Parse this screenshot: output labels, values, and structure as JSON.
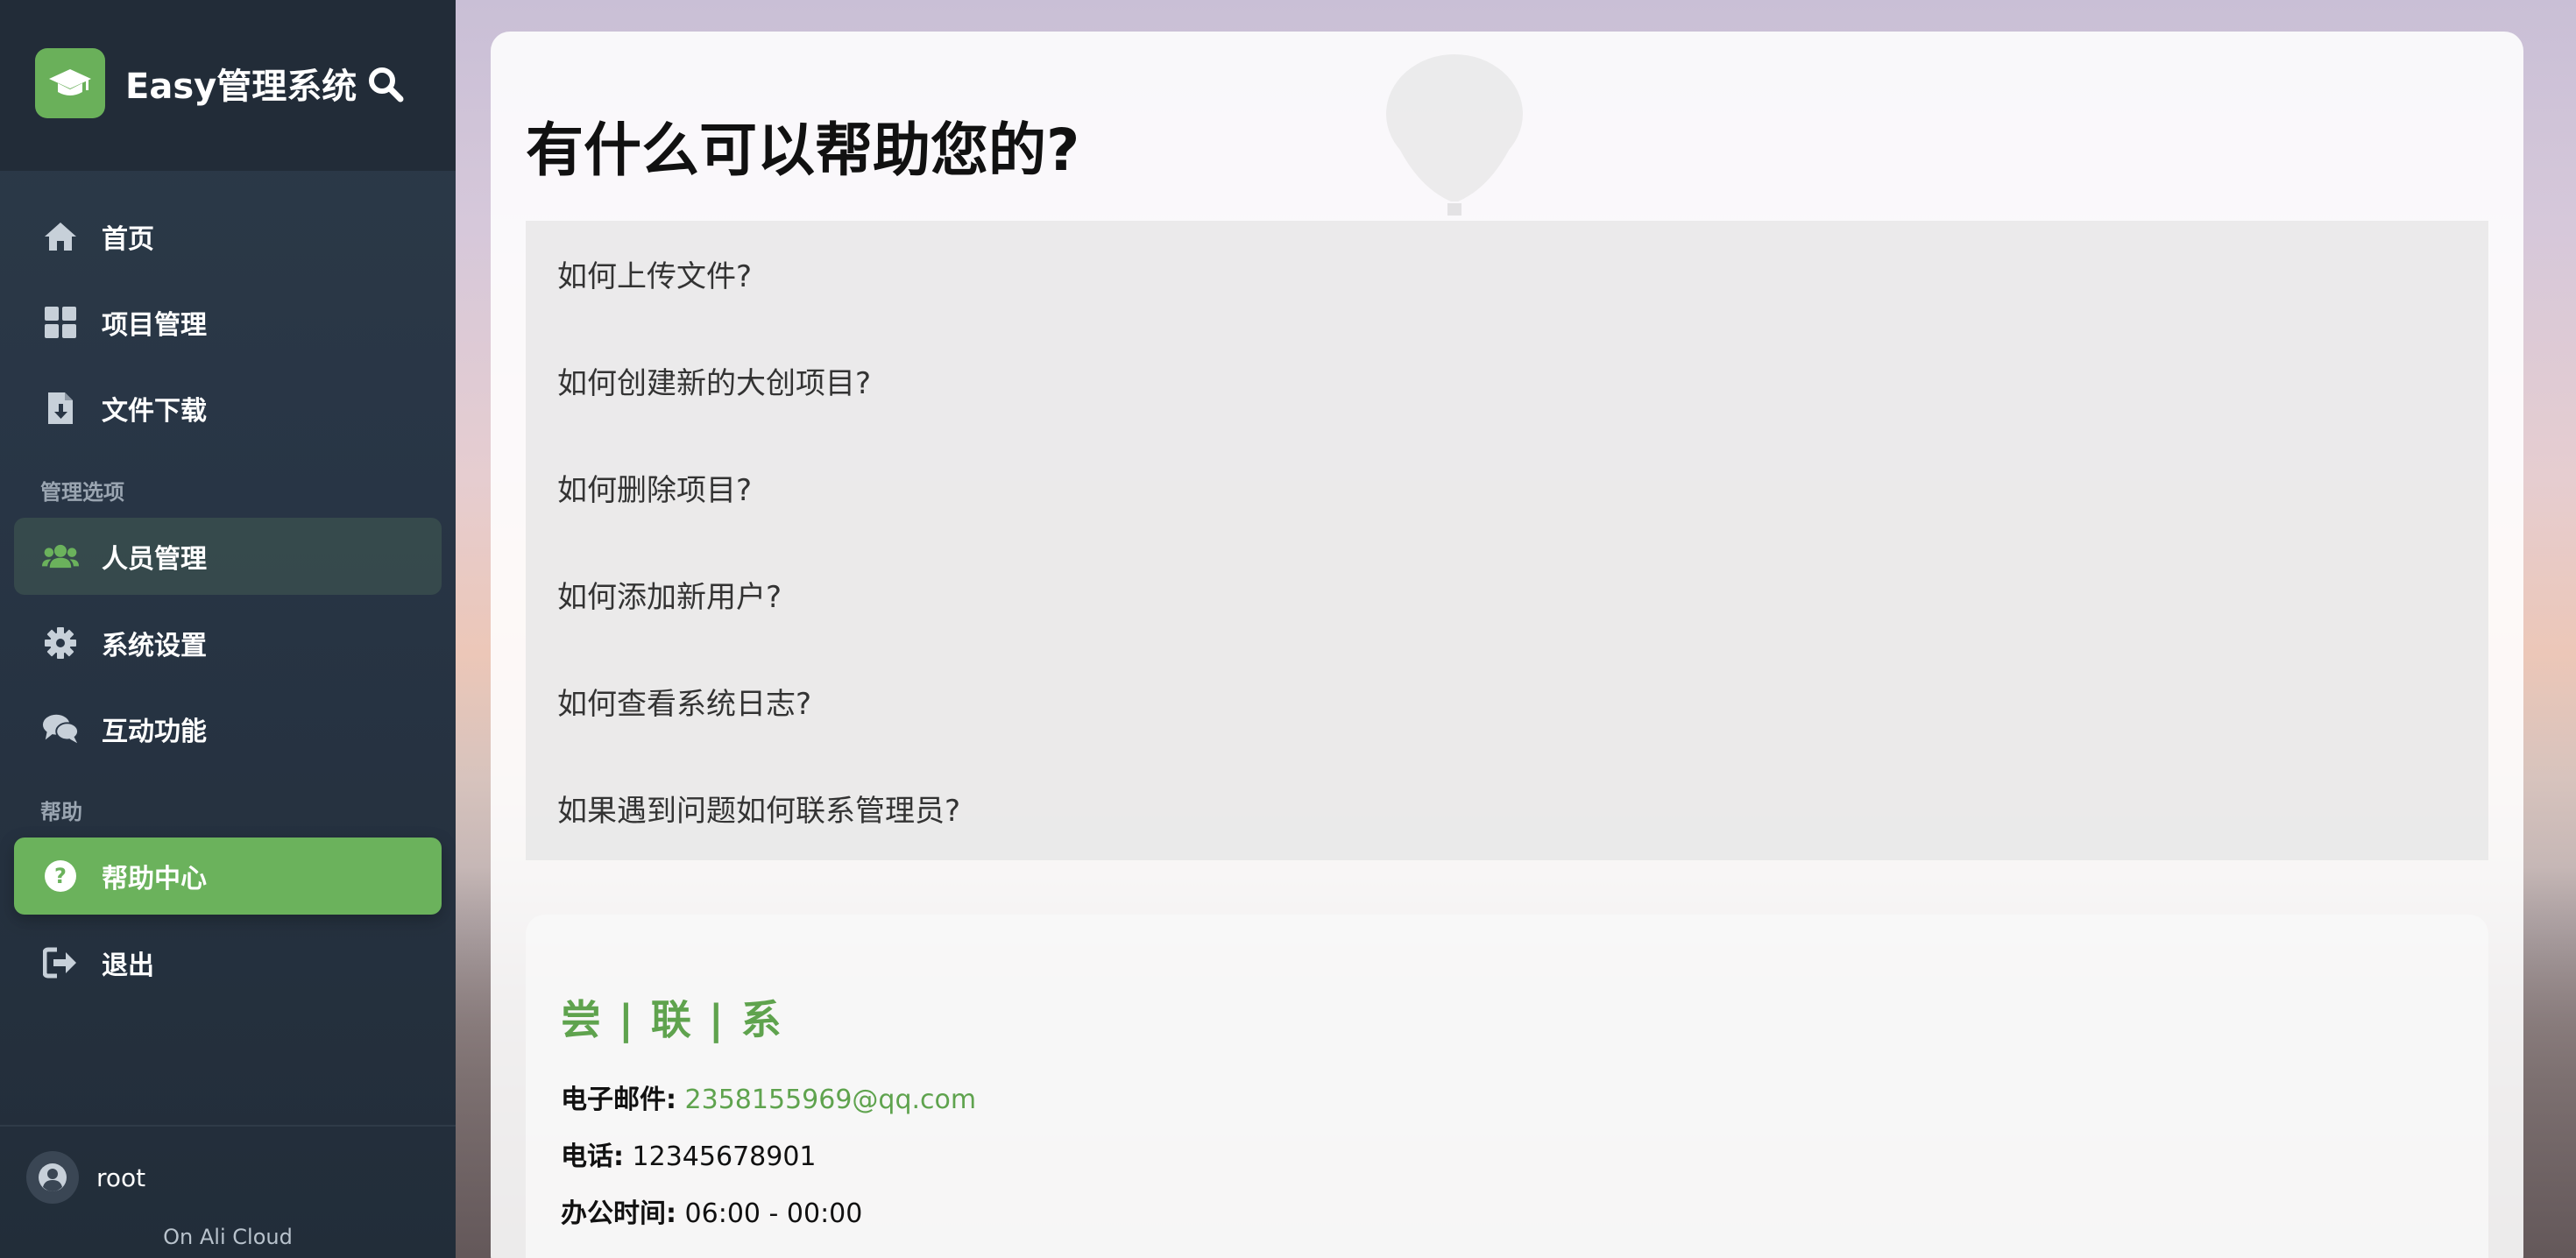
{
  "app": {
    "title": "Easy管理系统"
  },
  "sidebar": {
    "items": [
      {
        "label": "首页",
        "icon": "home-icon"
      },
      {
        "label": "项目管理",
        "icon": "grid-icon"
      },
      {
        "label": "文件下载",
        "icon": "file-download-icon"
      }
    ],
    "sections": [
      {
        "label": "管理选项"
      },
      {
        "label": "帮助"
      }
    ],
    "admin_items": [
      {
        "label": "人员管理",
        "icon": "users-icon"
      },
      {
        "label": "系统设置",
        "icon": "gear-icon"
      },
      {
        "label": "互动功能",
        "icon": "comments-icon"
      }
    ],
    "help_items": [
      {
        "label": "帮助中心",
        "icon": "question-circle-icon",
        "active": true
      },
      {
        "label": "退出",
        "icon": "sign-out-icon"
      }
    ],
    "user": {
      "name": "root"
    },
    "footer_note": "On Ali Cloud"
  },
  "main": {
    "title": "有什么可以帮助您的?",
    "faq": [
      "如何上传文件?",
      "如何创建新的大创项目?",
      "如何删除项目?",
      "如何添加新用户?",
      "如何查看系统日志?",
      "如果遇到问题如何联系管理员?"
    ],
    "contact": {
      "title": "尝 | 联 | 系",
      "email_label": "电子邮件:",
      "email_value": "2358155969@qq.com",
      "phone_label": "电话:",
      "phone_value": "12345678901",
      "hours_label": "办公时间:",
      "hours_value": "06:00 - 00:00"
    }
  },
  "colors": {
    "accent": "#6bb25c",
    "sidebar_bg": "#283545"
  }
}
